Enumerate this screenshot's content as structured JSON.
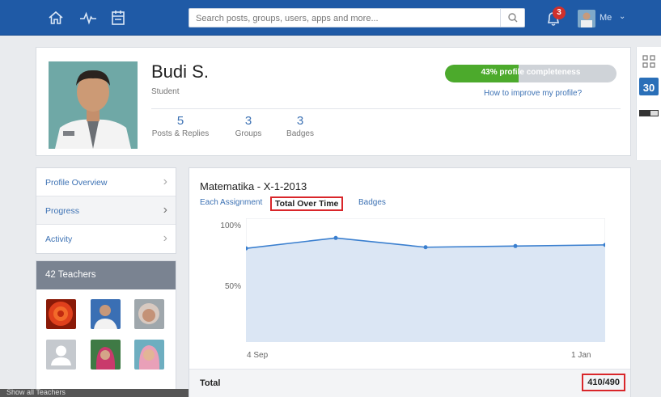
{
  "topbar": {
    "nav_icons": [
      "home-icon",
      "activity-icon",
      "calendar-icon"
    ],
    "search_placeholder": "Search posts, groups, users, apps and more...",
    "notification_count": "3",
    "me_label": "Me"
  },
  "profile": {
    "name": "Budi S.",
    "role": "Student",
    "completeness_text": "43% profile completeness",
    "completeness_percent": 43,
    "improve_link": "How to improve my profile?",
    "stats": [
      {
        "value": "5",
        "label": "Posts & Replies"
      },
      {
        "value": "3",
        "label": "Groups"
      },
      {
        "value": "3",
        "label": "Badges"
      }
    ]
  },
  "sidebar": {
    "items": [
      {
        "label": "Profile Overview"
      },
      {
        "label": "Progress"
      },
      {
        "label": "Activity"
      }
    ],
    "teachers_heading": "42 Teachers",
    "show_all": "Show all Teachers"
  },
  "course": {
    "title": "Matematika - X-1-2013",
    "tabs": [
      {
        "label": "Each Assignment"
      },
      {
        "label": "Total Over Time"
      },
      {
        "label": "Badges"
      }
    ],
    "total_label": "Total",
    "total_value": "410/490"
  },
  "chart_data": {
    "type": "area",
    "y_tick_labels": [
      "100%",
      "50%"
    ],
    "x_tick_labels": [
      "4 Sep",
      "1 Jan"
    ],
    "ylim": [
      0,
      100
    ],
    "values": [
      81,
      90,
      82,
      83,
      84
    ],
    "fill_color": "#dbe6f4",
    "line_color": "#3a7fcf"
  },
  "colors": {
    "topbar": "#1f5aa6",
    "link": "#3d72b4",
    "progress": "#4caa2c",
    "highlight": "#d9262a"
  }
}
